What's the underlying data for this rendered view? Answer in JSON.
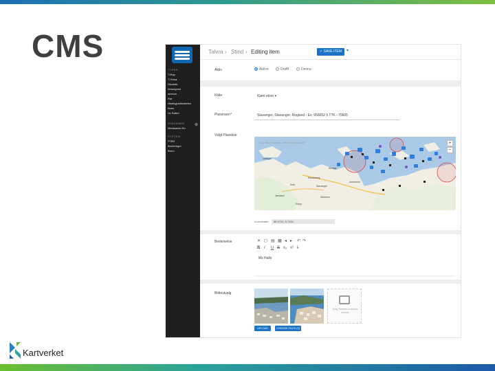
{
  "slide": {
    "title": "CMS",
    "brand": {
      "name": "Kartverket",
      "colors": {
        "green": "#6cbf2f",
        "blue": "#1c5aa8",
        "teal": "#2aa29a"
      }
    }
  },
  "cms": {
    "sidebar": {
      "section1_head": "TYPER",
      "section1_items": [
        "T-Rap",
        "T-Tema",
        "Dsvdsfs",
        "Amazgunn",
        "mrezze",
        "Rar",
        "Skarbyjubilkarteten",
        "Boes",
        "Vs Rated"
      ],
      "section2_head": "SVAKEMER",
      "section2_items": [
        "Mediaarkiv-Ro"
      ],
      "section3_head": "SYSTEM",
      "section3_items": [
        "FTBS",
        "Brukeregm",
        "Brum"
      ]
    },
    "topbar": {
      "crumbs": [
        "Talvra",
        "Stind",
        "Editing item"
      ],
      "save_label": "✓ SAVE ITEM",
      "save_caret": "▾"
    },
    "form": {
      "status_label": "Aktiv",
      "status_options": [
        "Aktive",
        "Drafft",
        "Denna"
      ],
      "kilde_label": "Kilde",
      "kilde_value": "Kjønt etsre",
      "kilde_caret": "▾",
      "plassnavn_label": "Plassnavn*",
      "plassnavn_value": "Stavanger, Stavanger, Rogland - Ex: 958652 5 T?K - 75605",
      "map_label": "Valgt Plasskoe",
      "map_search_placeholder": "Søk etter adresse, sted eller posisjon",
      "map_places": [
        "Vaslegd",
        "Arnegg",
        "Randaberg",
        "Sola",
        "Stavanger",
        "Jærsand",
        "Sandnes",
        "Amenland",
        "Klepp"
      ],
      "zoom_in": "+",
      "zoom_out": "−",
      "coord_label": "Koordinater:",
      "coord_value": "58.9700, 5.7331",
      "beskrivelse_label": "Beskrivelse",
      "toolbar1": [
        "✕",
        "◻",
        "▤",
        "▦",
        "◂",
        "▸",
        "↶",
        "↷"
      ],
      "toolbar2": [
        "B",
        "I",
        "U",
        "S",
        "x₂",
        "x²",
        "I̶"
      ],
      "editor_text": "Ms Hallo",
      "bildeutvalg_label": "Bildeutvalg",
      "add_image_text": "Drag Pictures or click to browse",
      "upload_label": "UPLOAD",
      "choose_label": "CHOOSE FILES (3)"
    }
  }
}
